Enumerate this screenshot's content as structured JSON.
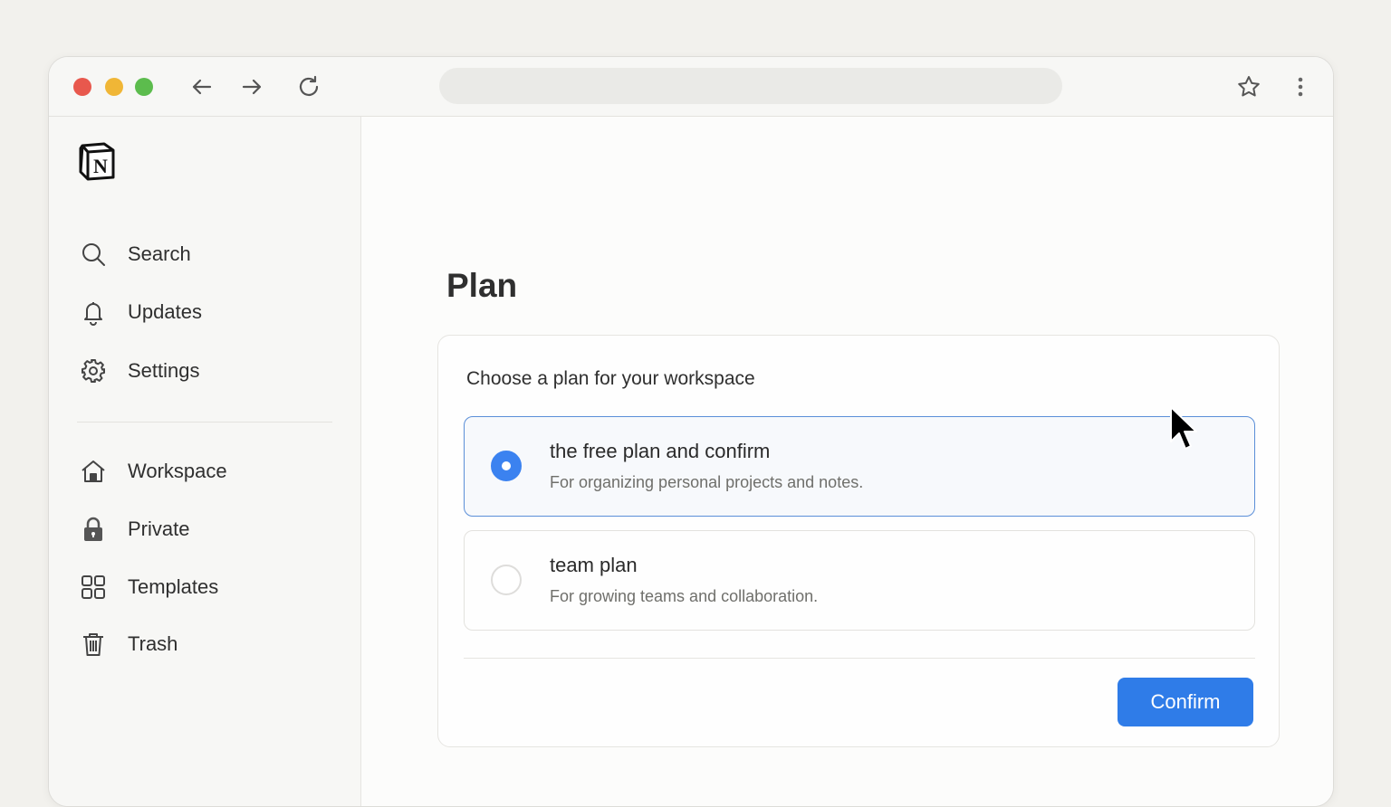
{
  "browser": {
    "url": "",
    "back_icon": "arrow-left-icon",
    "forward_icon": "arrow-right-icon",
    "reload_icon": "reload-icon",
    "bookmark_icon": "star-icon",
    "menu_icon": "kebab-menu-icon"
  },
  "sidebar": {
    "logo": "notion-logo",
    "top_items": [
      {
        "label": "Search",
        "icon": "search-icon"
      },
      {
        "label": "Updates",
        "icon": "bell-icon"
      },
      {
        "label": "Settings",
        "icon": "gear-icon"
      }
    ],
    "bottom_items": [
      {
        "label": "Workspace",
        "icon": "home-icon"
      },
      {
        "label": "Private",
        "icon": "lock-icon"
      },
      {
        "label": "Templates",
        "icon": "grid-icon"
      },
      {
        "label": "Trash",
        "icon": "trash-icon"
      }
    ]
  },
  "main": {
    "title": "Plan",
    "card": {
      "heading": "Choose a plan for your workspace",
      "options": [
        {
          "name": "the free plan and confirm",
          "description": "For organizing personal projects and notes.",
          "selected": true
        },
        {
          "name": "team plan",
          "description": "For growing teams and collaboration.",
          "selected": false
        }
      ],
      "confirm_label": "Confirm"
    }
  },
  "colors": {
    "accent": "#2f7ce8",
    "radio_selected": "#3b82f0",
    "selected_border": "#5b8fd8",
    "traffic_red": "#e8584d",
    "traffic_yellow": "#f0b636",
    "traffic_green": "#5cbc4d"
  }
}
